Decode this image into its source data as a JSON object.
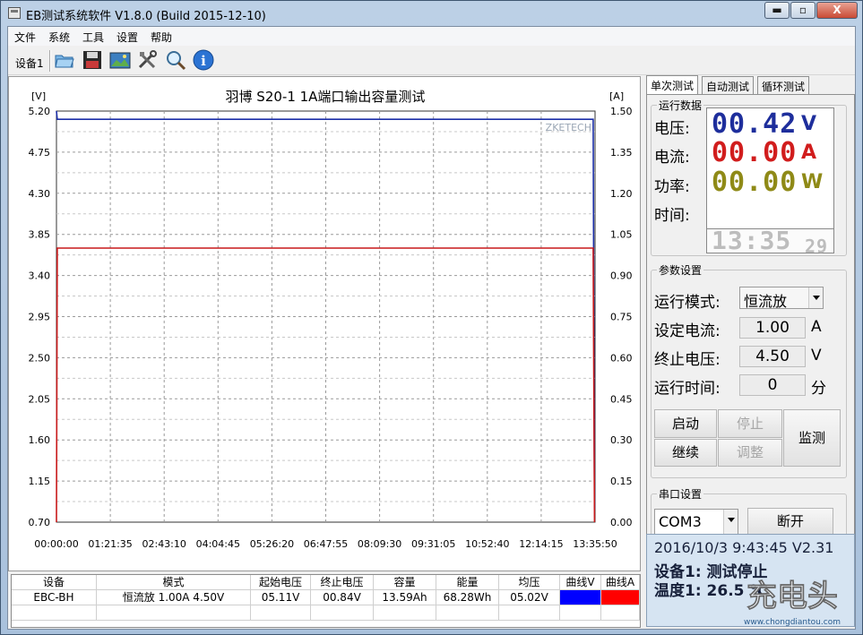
{
  "window": {
    "title": "EB测试系统软件 V1.8.0 (Build 2015-12-10)",
    "buttons": {
      "minimize": "▬",
      "maximize": "▫",
      "close": "X"
    }
  },
  "menu": [
    "文件",
    "系统",
    "工具",
    "设置",
    "帮助"
  ],
  "toolbar": {
    "device_label": "设备1",
    "icons": [
      "folder-open-icon",
      "save-disk-icon",
      "image-chart-icon",
      "tools-icon",
      "magnifier-icon",
      "info-icon"
    ]
  },
  "chart_data": {
    "type": "line",
    "title": "羽博 S20-1 1A端口输出容量测试",
    "watermark": "ZKETECH",
    "y_left_unit": "[V]",
    "y_right_unit": "[A]",
    "y_left_ticks": [
      "5.20",
      "4.75",
      "4.30",
      "3.85",
      "3.40",
      "2.95",
      "2.50",
      "2.05",
      "1.60",
      "1.15",
      "0.70"
    ],
    "y_right_ticks": [
      "1.50",
      "1.35",
      "1.20",
      "1.05",
      "0.90",
      "0.75",
      "0.60",
      "0.45",
      "0.30",
      "0.15",
      "0.00"
    ],
    "x_ticks": [
      "00:00:00",
      "01:21:35",
      "02:43:10",
      "04:04:45",
      "05:26:20",
      "06:47:55",
      "08:09:30",
      "09:31:05",
      "10:52:40",
      "12:14:15",
      "13:35:50"
    ],
    "ylim_left": [
      0.7,
      5.2
    ],
    "ylim_right": [
      0.0,
      1.5
    ],
    "grid": true,
    "series": [
      {
        "axis": "left",
        "color": "#1c2fa8",
        "points": [
          [
            0,
            5.2
          ],
          [
            0.02,
            5.11
          ],
          [
            13.55,
            5.11
          ],
          [
            13.583,
            0.84
          ]
        ]
      },
      {
        "axis": "right",
        "color": "#c8191a",
        "points": [
          [
            0,
            0.0
          ],
          [
            0.02,
            1.0
          ],
          [
            13.55,
            1.0
          ],
          [
            13.583,
            0.0
          ]
        ]
      }
    ],
    "x_max_hours": 13.597
  },
  "tabs": [
    "单次测试",
    "自动测试",
    "循环测试"
  ],
  "run_data": {
    "title": "运行数据",
    "voltage": {
      "label": "电压:",
      "value": "00.42",
      "unit": "V",
      "color": "#1e2e9c"
    },
    "current": {
      "label": "电流:",
      "value": "00.00",
      "unit": "A",
      "color": "#d11d1d"
    },
    "power": {
      "label": "功率:",
      "value": "00.00",
      "unit": "W",
      "color": "#8f8a17"
    },
    "time": {
      "label": "时间:",
      "value": "13:35",
      "seconds": "29"
    }
  },
  "params": {
    "title": "参数设置",
    "mode": {
      "label": "运行模式:",
      "value": "恒流放"
    },
    "current": {
      "label": "设定电流:",
      "value": "1.00",
      "unit": "A"
    },
    "cutoff": {
      "label": "终止电压:",
      "value": "4.50",
      "unit": "V"
    },
    "runtime": {
      "label": "运行时间:",
      "value": "0",
      "unit": "分"
    },
    "buttons": {
      "start": "启动",
      "stop": "停止",
      "monitor": "监测",
      "resume": "继续",
      "adjust": "调整"
    }
  },
  "serial": {
    "title": "串口设置",
    "port": "COM3",
    "disconnect": "断开"
  },
  "table": {
    "headers": [
      "设备",
      "模式",
      "起始电压",
      "终止电压",
      "容量",
      "能量",
      "均压",
      "曲线V",
      "曲线A"
    ],
    "row": {
      "device": "EBC-BH",
      "mode": "恒流放 1.00A 4.50V",
      "start_v": "05.11V",
      "end_v": "00.84V",
      "capacity": "13.59Ah",
      "energy": "68.28Wh",
      "avg_v": "05.02V",
      "curve_v_color": "#0000ff",
      "curve_a_color": "#ff0000"
    }
  },
  "status": {
    "line1": "2016/10/3 9:43:45  V2.31",
    "line2": "设备1: 测试停止",
    "line3": "温度1: 26.5 ℃"
  },
  "watermark": {
    "brand": "充电头",
    "url": "www.chongdiantou.com"
  }
}
